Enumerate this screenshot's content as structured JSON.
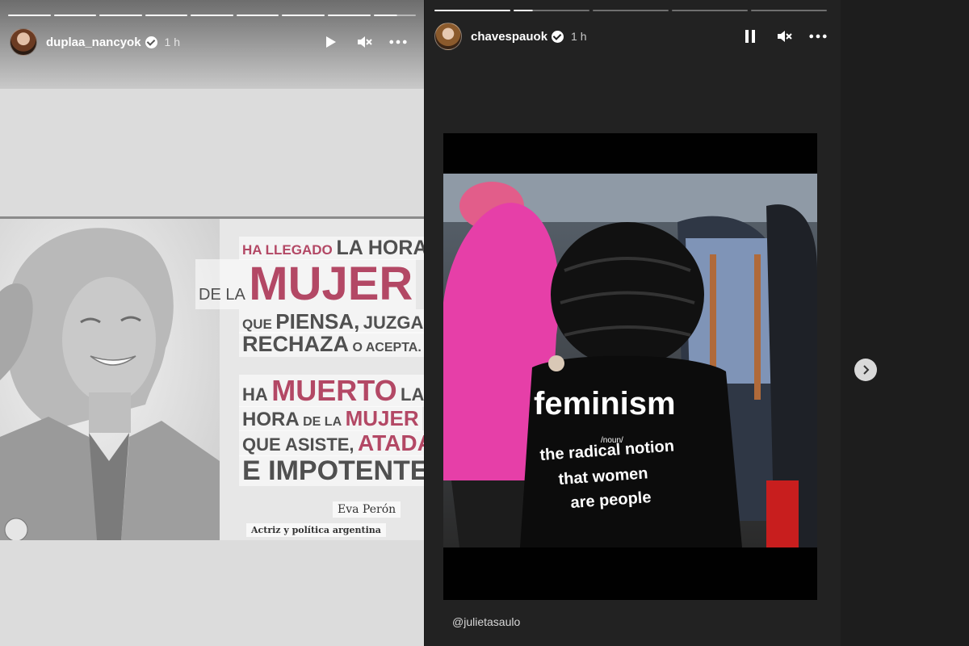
{
  "left_story": {
    "username": "duplaa_nancyok",
    "time": "1 h",
    "progress": {
      "total": 9,
      "done": 8,
      "current_fraction": 0.55
    },
    "quote": {
      "line1_a": "HA LLEGADO",
      "line1_b": "LA HORA",
      "line2_a": "DE LA",
      "line2_b": "MUJER",
      "line3_a": "QUE",
      "line3_b": "PIENSA,",
      "line3_c": "JUZGA,",
      "line4_a": "RECHAZA",
      "line4_b": "O ACEPTA.",
      "line5_a": "HA",
      "line5_b": "MUERTO",
      "line5_c": "LA",
      "line6_a": "HORA",
      "line6_b": "DE LA",
      "line6_c": "MUJER",
      "line7_a": "QUE ASISTE,",
      "line7_b": "ATADA",
      "line8": "E IMPOTENTE"
    },
    "author_name": "Eva Perón",
    "author_desc": "Actriz y política argentina"
  },
  "right_story": {
    "username": "chavespauok",
    "time": "1 h",
    "progress": {
      "total": 5,
      "done": 1,
      "current_fraction": 0.25
    },
    "shirt": {
      "word": "feminism",
      "pos": "/noun/",
      "def1": "the radical notion",
      "def2": "that women",
      "def3": "are people"
    },
    "mention": "@julietasaulo"
  },
  "colors": {
    "accent_pink": "#b34865",
    "quote_gray": "#505050",
    "dark_bg": "#222222"
  },
  "icons": {
    "play": "play-icon",
    "pause": "pause-icon",
    "mute": "mute-icon",
    "more": "more-icon",
    "next": "chevron-right-icon"
  }
}
